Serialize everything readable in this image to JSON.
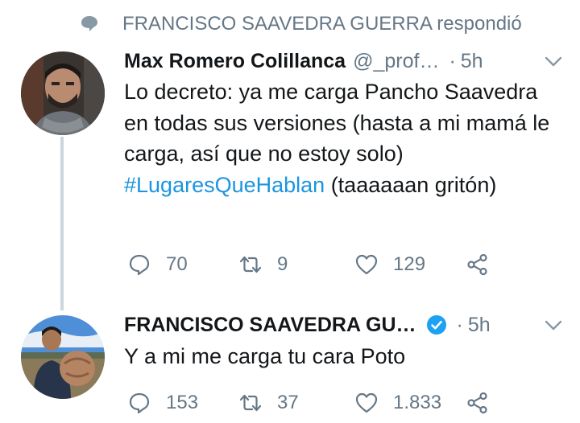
{
  "context": {
    "text": "FRANCISCO SAAVEDRA GUERRA respondió"
  },
  "tweets": [
    {
      "name": "Max Romero Colillanca",
      "handle": "@_prof…",
      "dot": "·",
      "time": "5h",
      "text_before": "Lo decreto: ya me carga Pancho Saavedra en todas sus versiones (hasta a mi mamá le carga, así que no estoy solo) ",
      "hashtag": "#LugaresQueHablan",
      "text_after": " (taaaaaan gritón)",
      "replies": "70",
      "retweets": "9",
      "likes": "129"
    },
    {
      "name": "FRANCISCO SAAVEDRA GU…",
      "verified": true,
      "dot": "·",
      "time": "5h",
      "text": "Y a mi me carga tu cara Poto",
      "replies": "153",
      "retweets": "37",
      "likes": "1.833"
    }
  ],
  "colors": {
    "accent": "#1b95e0",
    "muted": "#657786",
    "text": "#14171a",
    "line": "#ccd6dd"
  },
  "icons": [
    "reply-context-icon",
    "chevron-down-icon",
    "verified-badge-icon",
    "reply-icon",
    "retweet-icon",
    "like-icon",
    "share-icon"
  ]
}
